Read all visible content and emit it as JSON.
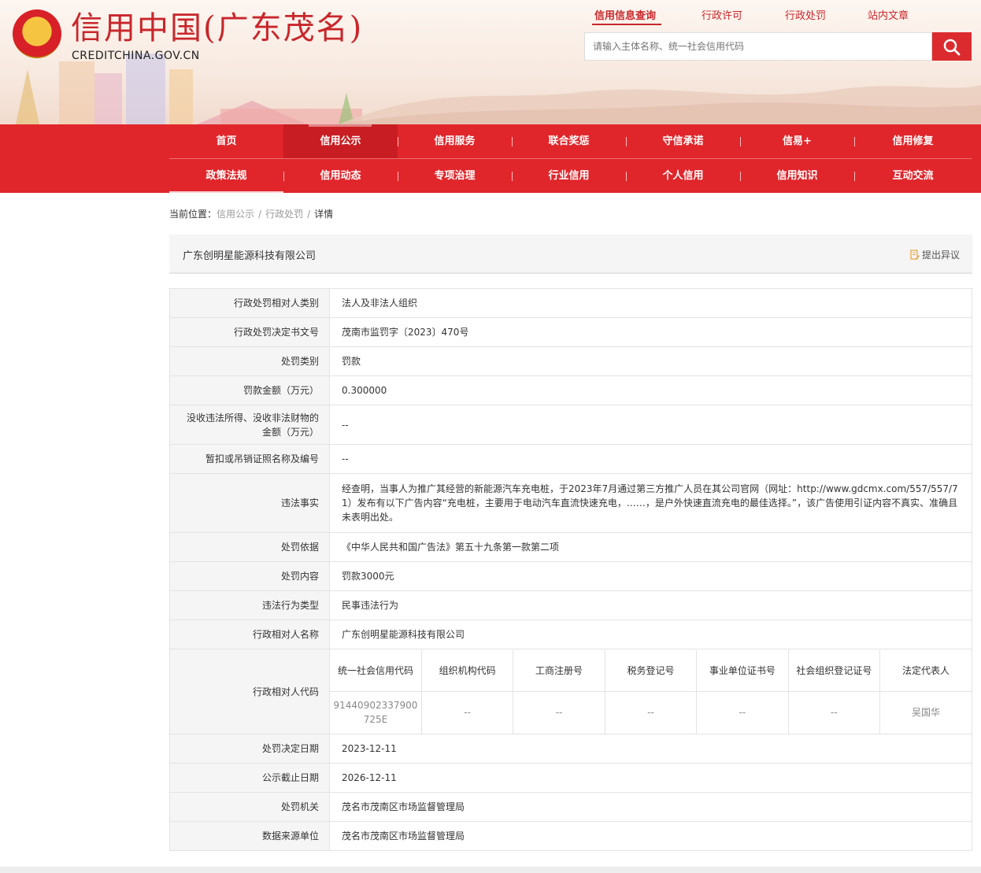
{
  "header": {
    "title": "信用中国(广东茂名)",
    "domain": "CREDITCHINA.GOV.CN",
    "top_links": [
      {
        "label": "信用信息查询",
        "active": true
      },
      {
        "label": "行政许可",
        "active": false
      },
      {
        "label": "行政处罚",
        "active": false
      },
      {
        "label": "站内文章",
        "active": false
      }
    ],
    "search_placeholder": "请输入主体名称、统一社会信用代码",
    "search_icon": "search-icon"
  },
  "nav": {
    "row1": [
      "首页",
      "信用公示",
      "信用服务",
      "联合奖惩",
      "守信承诺",
      "信易+",
      "信用修复"
    ],
    "row2": [
      "政策法规",
      "信用动态",
      "专项治理",
      "行业信用",
      "个人信用",
      "信用知识",
      "互动交流"
    ],
    "active": "信用公示"
  },
  "breadcrumb": {
    "prefix": "当前位置：",
    "items": [
      "信用公示",
      "行政处罚"
    ],
    "separator": "/",
    "current": "详情"
  },
  "company": {
    "name": "广东创明星能源科技有限公司",
    "objection_label": "提出异议"
  },
  "details": [
    {
      "label": "行政处罚相对人类别",
      "value": "法人及非法人组织"
    },
    {
      "label": "行政处罚决定书文号",
      "value": "茂南市监罚字〔2023〕470号"
    },
    {
      "label": "处罚类别",
      "value": "罚款"
    },
    {
      "label": "罚款金额（万元）",
      "value": "0.300000"
    },
    {
      "label": "没收违法所得、没收非法财物的金额（万元）",
      "value": "--"
    },
    {
      "label": "暂扣或吊销证照名称及编号",
      "value": "--"
    },
    {
      "label": "违法事实",
      "value": "经查明，当事人为推广其经营的新能源汽车充电桩，于2023年7月通过第三方推广人员在其公司官网（网址：http://www.gdcmx.com/557/557/71）发布有以下广告内容“充电桩，主要用于电动汽车直流快速充电，……，是户外快速直流充电的最佳选择。”，该广告使用引证内容不真实、准确且未表明出处。"
    },
    {
      "label": "处罚依据",
      "value": "《中华人民共和国广告法》第五十九条第一款第二项"
    },
    {
      "label": "处罚内容",
      "value": "罚款3000元"
    },
    {
      "label": "违法行为类型",
      "value": "民事违法行为"
    },
    {
      "label": "行政相对人名称",
      "value": "广东创明星能源科技有限公司"
    }
  ],
  "codes": {
    "label": "行政相对人代码",
    "headers": [
      "统一社会信用代码",
      "组织机构代码",
      "工商注册号",
      "税务登记号",
      "事业单位证书号",
      "社会组织登记证号",
      "法定代表人"
    ],
    "values": [
      "91440902337900725E",
      "--",
      "--",
      "--",
      "--",
      "--",
      "吴国华"
    ]
  },
  "details_after": [
    {
      "label": "处罚决定日期",
      "value": "2023-12-11"
    },
    {
      "label": "公示截止日期",
      "value": "2026-12-11"
    },
    {
      "label": "处罚机关",
      "value": "茂名市茂南区市场监督管理局"
    },
    {
      "label": "数据来源单位",
      "value": "茂名市茂南区市场监督管理局"
    }
  ],
  "colors": {
    "brand_red": "#e0262b",
    "title_red": "#c9262b"
  }
}
